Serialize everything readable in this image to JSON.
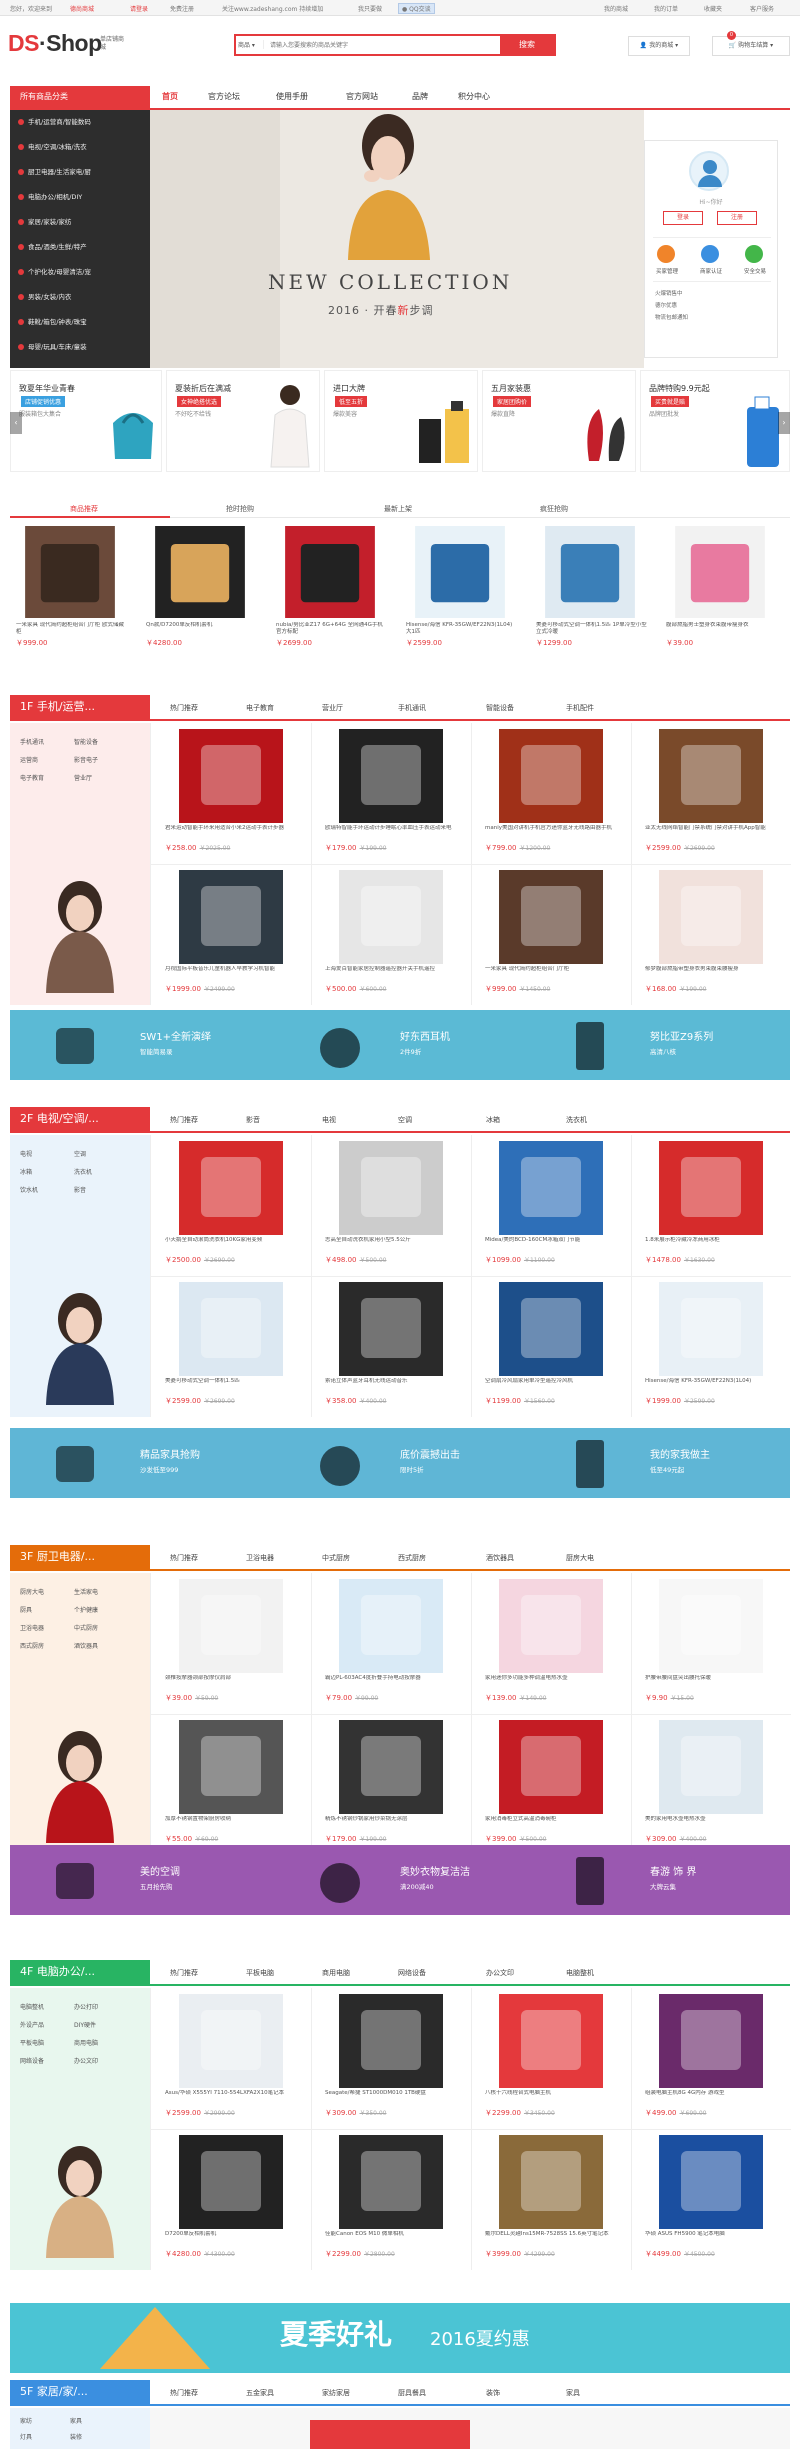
{
  "topbar": {
    "greet": "您好，欢迎来到",
    "shop": "德尚商城",
    "login": "请登录",
    "register": "免费注册",
    "follow": "关注www.zadeshang.com 持续增加",
    "agent": "我只要做",
    "qq": "QQ交谈",
    "links": [
      "我的商城",
      "我的订单",
      "收藏夹",
      "客户服务"
    ]
  },
  "logo": {
    "ds": "DS",
    "shop": "Shop",
    "sub": "单店铺商城"
  },
  "search": {
    "category": "商品",
    "placeholder": "请输入您要搜索的商品关键字",
    "button": "搜索"
  },
  "header": {
    "mall": "我的商城",
    "cart": "购物车结算",
    "cart_count": "0"
  },
  "nav": {
    "all_categories": "所有商品分类",
    "links": [
      "首页",
      "官方论坛",
      "使用手册",
      "官方网站",
      "品牌",
      "积分中心"
    ]
  },
  "categories": [
    "手机/运营商/智能数码",
    "电视/空调/冰箱/洗衣",
    "厨卫电器/生活家电/厨",
    "电脑办公/相机/DIY",
    "家居/家装/家纺",
    "食品/酒类/生鲜/特产",
    "个护化妆/母婴清洁/宠",
    "男装/女装/内衣",
    "鞋靴/箱包/钟表/珠宝",
    "母婴/玩具/车床/童装"
  ],
  "banner": {
    "title": "NEW COLLECTION",
    "year": "2016 · 开春",
    "hl": "新",
    "tail": "步调"
  },
  "user": {
    "name": "Hi~你好",
    "login": "登录",
    "register": "注册",
    "icons": [
      "买家管理",
      "商家认证",
      "安全交易"
    ],
    "links": [
      "火爆销售中",
      "德尔优惠",
      "物流包邮通知"
    ]
  },
  "promos": [
    {
      "title": "致夏年华业青春",
      "badge": "店铺促销优惠",
      "sub": "服装箱包大集合",
      "color": "#3aa0e0"
    },
    {
      "title": "夏装折后在满减",
      "badge": "女神绝搭优选",
      "sub": "不好吃不给钱",
      "color": "#e4393c"
    },
    {
      "title": "进口大牌",
      "badge": "低至五折",
      "sub": "爆款美容",
      "color": "#e4393c"
    },
    {
      "title": "五月家装惠",
      "badge": "家居团购价",
      "sub": "爆款直降",
      "color": "#e4393c"
    },
    {
      "title": "品牌特购9.9元起",
      "badge": "买贵就是赔",
      "sub": "品牌团批发",
      "color": "#e4393c"
    }
  ],
  "hot_tabs": [
    "商品推荐",
    "抢时抢购",
    "最新上架",
    "疯狂抢购"
  ],
  "hot_items": [
    {
      "name": "一米家具 现代简约超柜组合门厅柜 欧式储藏柜",
      "price": "￥999.00"
    },
    {
      "name": "Qn款/D7200单反相机套机",
      "price": "￥4280.00"
    },
    {
      "name": "nubia/努比亚Z17 6G+64G 全网通4G手机 官方标配",
      "price": "￥2699.00"
    },
    {
      "name": "Hisense/海信 KFR-35GW/EF22N3(1L04) 大1匹",
      "price": "￥2599.00"
    },
    {
      "name": "美菱可移动式空调一体机1.5匹 1P单冷型小型立式冷暖",
      "price": "￥1299.00"
    },
    {
      "name": "腹部燃脂男士塑身衣束腹带瘦身衣",
      "price": "￥39.00"
    }
  ],
  "floors": [
    {
      "title": "1F  手机/运营...",
      "color": "#e4393c",
      "tabs": [
        "热门推荐",
        "电子教育",
        "营业厅",
        "手机通讯",
        "智能设备",
        "手机配件"
      ],
      "keys": [
        "手机通讯",
        "智能设备",
        "运营商",
        "影音电子",
        "电子教育",
        "营业厅"
      ],
      "items": [
        {
          "name": "君米运动智能手环来用适合小米2运动手表计步器",
          "price": "￥258.00",
          "op": "￥2025.00"
        },
        {
          "name": "欧瑞特智能手环运动计步睡眠心率血压手表运动来电",
          "price": "￥179.00",
          "op": "￥199.00"
        },
        {
          "name": "maniy美国对讲机手机官方迷你蓝牙无线路由器手机",
          "price": "￥799.00",
          "op": "￥1200.00"
        },
        {
          "name": "亚太无线网络智能门禁系统门禁对讲手机App智能",
          "price": "￥2599.00",
          "op": "￥2699.00"
        },
        {
          "name": "月视国际平板音乐儿童机器人早教学习机智能",
          "price": "￥1999.00",
          "op": "￥2499.00"
        },
        {
          "name": "上海爱百智能家居控制器遥控器开关手机遥控",
          "price": "￥500.00",
          "op": "￥600.00"
        },
        {
          "name": "一米家具 现代简约超柜组合门厅柜",
          "price": "￥999.00",
          "op": "￥1450.00"
        },
        {
          "name": "郁梦腹部燃脂带塑身衣男束腹束腰瘦身",
          "price": "￥168.00",
          "op": "￥199.00"
        }
      ]
    },
    {
      "title": "2F  电视/空调/...",
      "color": "#e4393c",
      "tabs": [
        "热门推荐",
        "影音",
        "电视",
        "空调",
        "冰箱",
        "洗衣机"
      ],
      "keys": [
        "电视",
        "空调",
        "冰箱",
        "洗衣机",
        "饮水机",
        "影音"
      ],
      "items": [
        {
          "name": "小天鹅全自动滚筒洗衣机10KG家用变频",
          "price": "￥2500.00",
          "op": "￥2690.00"
        },
        {
          "name": "志高全自动洗衣机家用小型5.5公斤",
          "price": "￥498.00",
          "op": "￥500.00"
        },
        {
          "name": "Midea/美的BCD-160CM冰箱双门节能",
          "price": "￥1099.00",
          "op": "￥1100.00"
        },
        {
          "name": "1.8米展示柜冷藏冷冻商用冰柜",
          "price": "￥1478.00",
          "op": "￥1630.00"
        },
        {
          "name": "美菱可移动式空调一体机1.5匹",
          "price": "￥2599.00",
          "op": "￥2699.00"
        },
        {
          "name": "索诺立体声蓝牙耳机无线运动音乐",
          "price": "￥358.00",
          "op": "￥400.00"
        },
        {
          "name": "空调扇冷风扇家用单冷型遥控冷风机",
          "price": "￥1199.00",
          "op": "￥1560.00"
        },
        {
          "name": "Hisense/海信 KFR-35GW/EF22N3(1L04)",
          "price": "￥1999.00",
          "op": "￥2599.00"
        }
      ]
    },
    {
      "title": "3F  厨卫电器/...",
      "color": "#e46c0a",
      "tabs": [
        "热门推荐",
        "卫浴电器",
        "中式厨房",
        "西式厨房",
        "酒饮器具",
        "厨房大电"
      ],
      "keys": [
        "厨房大电",
        "生活家电",
        "厨具",
        "个护健康",
        "卫浴电器",
        "中式厨房",
        "西式厨房",
        "酒饮器具"
      ],
      "items": [
        {
          "name": "颈椎按摩器颈部按摩仪肩部",
          "price": "￥39.00",
          "op": "￥59.00"
        },
        {
          "name": "霸迈PL-603AC4度折叠手持电动按摩器",
          "price": "￥79.00",
          "op": "￥99.00"
        },
        {
          "name": "家用迷你多功能多种调温电热水壶",
          "price": "￥139.00",
          "op": "￥149.00"
        },
        {
          "name": "护腰带腰间盘突出腰托保暖",
          "price": "￥9.90",
          "op": "￥15.00"
        },
        {
          "name": "加厚不锈钢置物架厨房收纳",
          "price": "￥55.00",
          "op": "￥69.00"
        },
        {
          "name": "精炼不锈钢炒锅家用炒菜锅无涂层",
          "price": "￥179.00",
          "op": "￥199.00"
        },
        {
          "name": "家用消毒柜立式高温消毒碗柜",
          "price": "￥399.00",
          "op": "￥500.00"
        },
        {
          "name": "美的家用电水壶电热水壶",
          "price": "￥309.00",
          "op": "￥400.00"
        }
      ]
    },
    {
      "title": "4F  电脑办公/...",
      "color": "#28b463",
      "tabs": [
        "热门推荐",
        "平板电脑",
        "商用电脑",
        "网络设备",
        "办公文印",
        "电脑整机"
      ],
      "keys": [
        "电脑整机",
        "办公打印",
        "外设产品",
        "DIY硬件",
        "平板电脑",
        "商用电脑",
        "网络设备",
        "办公文印"
      ],
      "items": [
        {
          "name": "Asus/华硕 X555YI 7110-554LXFA2X10笔记本",
          "price": "￥2599.00",
          "op": "￥2999.00"
        },
        {
          "name": "Seagate/希捷 ST1000DM010 1TB硬盘",
          "price": "￥309.00",
          "op": "￥350.00"
        },
        {
          "name": "八核十六线程台式电脑主机",
          "price": "￥2299.00",
          "op": "￥3450.00"
        },
        {
          "name": "组装电脑主机8G 4G内存 游戏型",
          "price": "￥499.00",
          "op": "￥699.00"
        },
        {
          "name": "D7200单反相机套机",
          "price": "￥4280.00",
          "op": "￥4300.00"
        },
        {
          "name": "佳能Canon EOS M10 微单相机",
          "price": "￥2299.00",
          "op": "￥2800.00"
        },
        {
          "name": "戴尔DELL灵越Ins15MR-7528SS 15.6英寸笔记本",
          "price": "￥3999.00",
          "op": "￥4299.00"
        },
        {
          "name": "华硕 ASUS FH5900 笔记本电脑",
          "price": "￥4499.00",
          "op": "￥4500.00"
        }
      ]
    }
  ],
  "ads": [
    {
      "a": "SW1+全新演绎",
      "b": "智能简易录",
      "c": "好东西耳机",
      "d": "2件9折",
      "e": "努比亚Z9系列",
      "f": "高清八核",
      "g": "#5bbad5"
    },
    {
      "a": "精品家具抢购",
      "b": "沙发低至999",
      "c": "底价震撼出击",
      "d": "限时5折",
      "e": "我的家我做主",
      "f": "低至49元起",
      "g": "#5fb6d6"
    },
    {
      "a": "美的空调",
      "b": "五月抢先购",
      "c": "奥妙衣物复洁洁",
      "d": "满200减40",
      "e": "春游 饰 界",
      "f": "大牌云集",
      "g": "#9a58b0"
    },
    {
      "a": "夏季好礼",
      "b": "2016夏约惠",
      "c": "",
      "d": "",
      "e": "",
      "f": "",
      "g": "#4bc4d4"
    }
  ],
  "floor5": {
    "title": "5F  家居/家/...",
    "tabs": [
      "热门推荐",
      "五金家具",
      "家纺家居",
      "厨具餐具",
      "装饰",
      "家具"
    ],
    "keys": [
      "家纺",
      "家具",
      "灯具",
      "装修"
    ]
  }
}
